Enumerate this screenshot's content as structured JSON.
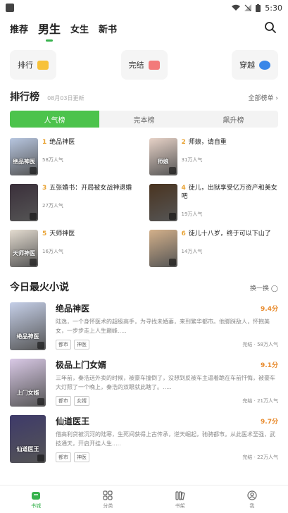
{
  "status": {
    "time": "5:30"
  },
  "topnav": {
    "tabs": [
      {
        "label": "推荐",
        "active": false
      },
      {
        "label": "男生",
        "active": true
      },
      {
        "label": "女生",
        "active": false
      },
      {
        "label": "新书",
        "active": false
      }
    ]
  },
  "categories": [
    {
      "label": "排行",
      "color": "#f7c23a"
    },
    {
      "label": "完结",
      "color": "#f27a7a"
    },
    {
      "label": "穿越",
      "color": "#3a87e8"
    }
  ],
  "ranking": {
    "title": "排行榜",
    "date": "08月03日更新",
    "more": "全部榜单 ›",
    "tabs": [
      "人气榜",
      "完本榜",
      "飙升榜"
    ],
    "items": [
      {
        "no": "1",
        "title": "绝品神医",
        "pop": "58万人气",
        "cover_label": "绝品神医",
        "cover_color": "#b7c6e0"
      },
      {
        "no": "2",
        "title": "师娘，请自重",
        "pop": "31万人气",
        "cover_label": "师娘",
        "cover_color": "#e7d2c7"
      },
      {
        "no": "3",
        "title": "五张婚书：开局被女战神退婚",
        "pop": "27万人气",
        "cover_label": "",
        "cover_color": "#3a2f3a"
      },
      {
        "no": "4",
        "title": "徒儿，出狱享受亿万资产和美女吧",
        "pop": "19万人气",
        "cover_label": "",
        "cover_color": "#4a3420"
      },
      {
        "no": "5",
        "title": "天师神医",
        "pop": "16万人气",
        "cover_label": "天师神医",
        "cover_color": "#e4dcd0"
      },
      {
        "no": "6",
        "title": "徒儿十八岁，终于可以下山了",
        "pop": "14万人气",
        "cover_label": "",
        "cover_color": "#d3b08a"
      }
    ]
  },
  "hot": {
    "title": "今日最火小说",
    "more": "换一换",
    "items": [
      {
        "name": "绝品神医",
        "score": "9.4分",
        "desc": "陆逸，一个身怀医术的超级高手，为寻找未婚妻，来到繁华都市。他脚踩敌人，怀抱美女，一步步走上人生巅峰.....",
        "tags": [
          "都市",
          "神医"
        ],
        "meta": "完结 · 58万人气",
        "cover_label": "绝品神医",
        "cover_color": "#c5cfe8"
      },
      {
        "name": "极品上门女婿",
        "score": "9.1分",
        "desc": "三年前，秦浩送外卖的时候，被豪车撞倒了，没想到反被车主逼着跪在车前忏悔，被豪车大灯照了一个晚上，秦浩的双眼就此瞎了。.....",
        "tags": [
          "都市",
          "女婿"
        ],
        "meta": "完结 · 21万人气",
        "cover_label": "上门女婿",
        "cover_color": "#d9c9e6"
      },
      {
        "name": "仙道医王",
        "score": "9.7分",
        "desc": "借高利贷被沉河的陆寒，生死间获得上古传承，逆天崛起，驰骋都市。从此医术至强，武技通天，开启开挂人生.....",
        "tags": [
          "都市",
          "神医"
        ],
        "meta": "完结 · 22万人气",
        "cover_label": "仙道医王",
        "cover_color": "#3e3a6a"
      }
    ]
  },
  "bottomnav": [
    {
      "label": "书城",
      "icon": "bookstore-icon",
      "active": true
    },
    {
      "label": "分类",
      "icon": "grid-icon",
      "active": false
    },
    {
      "label": "书架",
      "icon": "bookshelf-icon",
      "active": false
    },
    {
      "label": "我",
      "icon": "profile-icon",
      "active": false
    }
  ],
  "colors": {
    "accent": "#37b24d",
    "rank_no": "#e9a334",
    "score": "#e88a2c"
  }
}
